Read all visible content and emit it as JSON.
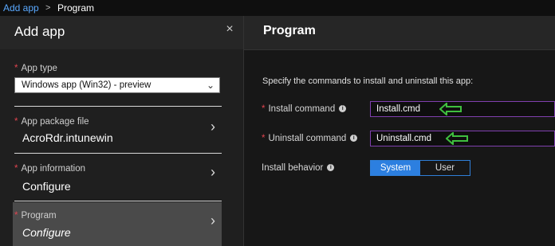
{
  "breadcrumb": {
    "link": "Add app",
    "separator": ">",
    "current": "Program"
  },
  "left_panel": {
    "title": "Add app",
    "close_glyph": "×",
    "app_type": {
      "label": "App type",
      "value": "Windows app (Win32) - preview"
    },
    "items": [
      {
        "label": "App package file",
        "value": "AcroRdr.intunewin"
      },
      {
        "label": "App information",
        "value": "Configure"
      },
      {
        "label": "Program",
        "value": "Configure"
      }
    ]
  },
  "right_panel": {
    "title": "Program",
    "description": "Specify the commands to install and uninstall this app:",
    "install_command": {
      "label": "Install command",
      "value": "Install.cmd"
    },
    "uninstall_command": {
      "label": "Uninstall command",
      "value": "Uninstall.cmd"
    },
    "install_behavior": {
      "label": "Install behavior",
      "options": [
        "System",
        "User"
      ],
      "selected": "System"
    }
  },
  "colors": {
    "accent": "#2c7fe0",
    "required": "#e0444f",
    "arrow": "#3fbf3f",
    "focus_border": "#7f3fae"
  },
  "icons": {
    "info": "info-icon",
    "chevron": "chevron-right-icon",
    "dropdown": "chevron-down-icon",
    "close": "close-icon"
  }
}
